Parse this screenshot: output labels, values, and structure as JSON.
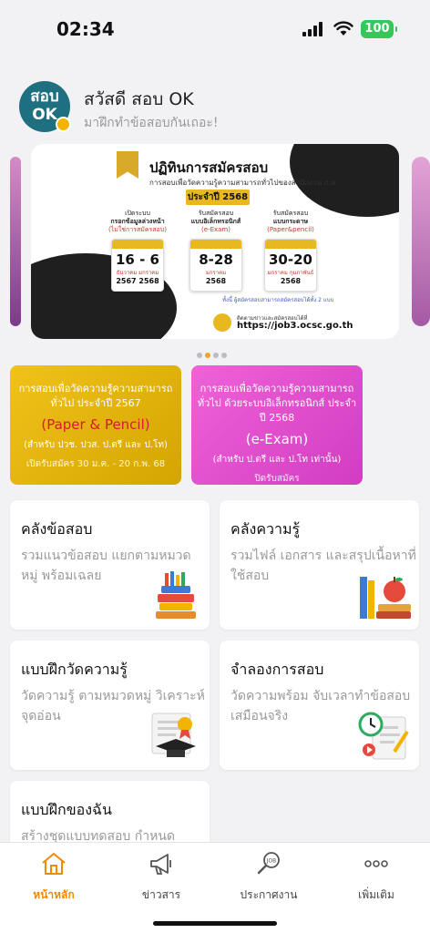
{
  "status_bar": {
    "time": "02:34",
    "battery": "100"
  },
  "greeting": {
    "avatar_text_1": "สอบ",
    "avatar_text_2": "OK",
    "hello": "สวัสดี สอบ OK",
    "sub": "มาฝึกทำข้อสอบกันเถอะ!"
  },
  "banner": {
    "title": "ปฏิทินการสมัครสอบ",
    "subtitle": "การสอบเพื่อวัดความรู้ความสามารถทั่วไปของสำนักงาน ก.พ.",
    "year": "ประจำปี 2568",
    "columns": [
      {
        "head_1": "เปิดระบบ",
        "head_2": "กรอกข้อมูลล่วงหน้า",
        "head_3": "(ไม่ใช่การสมัครสอบ)",
        "day": "16 - 6",
        "months": "ธันวาคม  มกราคม",
        "years": "2567  2568"
      },
      {
        "head_1": "รับสมัครสอบ",
        "head_2": "แบบอิเล็กทรอนิกส์",
        "head_3": "(e-Exam)",
        "day": "8-28",
        "months": "มกราคม",
        "years": "2568"
      },
      {
        "head_1": "รับสมัครสอบ",
        "head_2": "แบบกระดาษ",
        "head_3": "(Paper&pencil)",
        "day": "30-20",
        "months": "มกราคม  กุมภาพันธ์",
        "years": "2568"
      }
    ],
    "note": "ทั้งนี้ ผู้สมัครสอบสามารถสมัครสอบได้ทั้ง 2 แบบ",
    "follow_label": "ติดตามข่าวและสมัครสอบได้ที่",
    "url": "https://job3.ocsc.go.th"
  },
  "promos": [
    {
      "line1": "การสอบเพื่อวัดความรู้ความสามารถทั่วไป ประจำปี 2567",
      "mode": "(Paper & Pencil)",
      "for": "(สำหรับ ปวช. ปวส. ป.ตรี และ ป.โท)",
      "date": "เปิดรับสมัคร 30 ม.ค. - 20 ก.พ. 68"
    },
    {
      "line1": "การสอบเพื่อวัดความรู้ความสามารถทั่วไป ด้วยระบบอิเล็กทรอนิกส์ ประจำปี 2568",
      "mode": "(e-Exam)",
      "for": "(สำหรับ ป.ตรี และ ป.โท เท่านั้น)",
      "date": "ปิดรับสมัคร"
    }
  ],
  "cards": [
    {
      "title": "คลังข้อสอบ",
      "desc": "รวมแนวข้อสอบ แยกตามหมวดหมู่ พร้อมเฉลย"
    },
    {
      "title": "คลังความรู้",
      "desc": "รวมไฟล์ เอกสาร และสรุปเนื้อหาที่ใช้สอบ"
    },
    {
      "title": "แบบฝึกวัดความรู้",
      "desc": "วัดความรู้ ตามหมวดหมู่ วิเคราะห์จุดอ่อน"
    },
    {
      "title": "จำลองการสอบ",
      "desc": "วัดความพร้อม จับเวลาทำข้อสอบเสมือนจริง"
    },
    {
      "title": "แบบฝึกของฉัน",
      "desc": "สร้างชุดแบบทดสอบ กำหนด"
    }
  ],
  "nav": [
    {
      "label": "หน้าหลัก",
      "icon": "home-icon",
      "active": true
    },
    {
      "label": "ข่าวสาร",
      "icon": "megaphone-icon",
      "active": false
    },
    {
      "label": "ประกาศงาน",
      "icon": "job-search-icon",
      "active": false
    },
    {
      "label": "เพิ่มเติม",
      "icon": "more-icon",
      "active": false
    }
  ],
  "colors": {
    "accent": "#f08a00",
    "promo_yellow": "#f0c21a",
    "promo_pink": "#ef62d8",
    "avatar": "#1e6f7f"
  }
}
